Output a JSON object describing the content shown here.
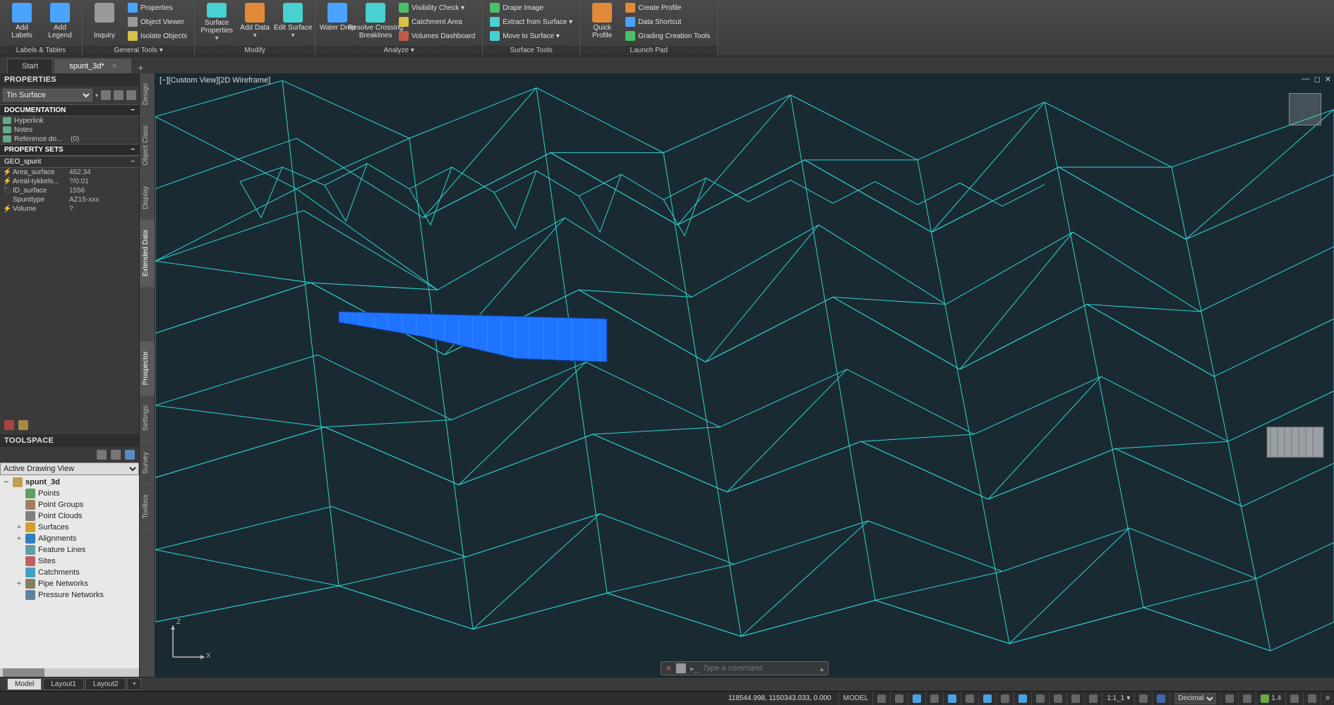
{
  "ribbon": {
    "groups": [
      {
        "label": "Labels & Tables",
        "big": [
          {
            "name": "add-labels",
            "label": "Add\nLabels",
            "ic": "blue"
          },
          {
            "name": "add-legend",
            "label": "Add\nLegend",
            "ic": "blue"
          }
        ]
      },
      {
        "label": "General Tools ▾",
        "big": [
          {
            "name": "inquiry",
            "label": "\nInquiry",
            "ic": "grey"
          }
        ],
        "stack": [
          {
            "name": "properties",
            "label": "Properties",
            "ic": "blue"
          },
          {
            "name": "object-viewer",
            "label": "Object Viewer",
            "ic": "grey"
          },
          {
            "name": "isolate-objects",
            "label": "Isolate Objects",
            "ic": "yellow"
          }
        ]
      },
      {
        "label": "Modify",
        "big": [
          {
            "name": "surface-properties",
            "label": "Surface\nProperties",
            "ic": "cyan",
            "dd": true
          },
          {
            "name": "add-data",
            "label": "Add Data\n",
            "ic": "orange",
            "dd": true
          },
          {
            "name": "edit-surface",
            "label": "Edit Surface\n",
            "ic": "cyan",
            "dd": true
          }
        ]
      },
      {
        "label": "Analyze ▾",
        "big": [
          {
            "name": "water-drop",
            "label": "Water Drop\n",
            "ic": "blue"
          },
          {
            "name": "resolve-crossing",
            "label": "Resolve Crossing\nBreaklines",
            "ic": "cyan"
          }
        ],
        "stack": [
          {
            "name": "visibility-check",
            "label": "Visibility Check ▾",
            "ic": "green"
          },
          {
            "name": "catchment-area",
            "label": "Catchment Area",
            "ic": "yellow"
          },
          {
            "name": "volumes-dashboard",
            "label": "Volumes Dashboard",
            "ic": "red"
          }
        ]
      },
      {
        "label": "Surface Tools",
        "stack": [
          {
            "name": "drape-image",
            "label": "Drape Image",
            "ic": "green"
          },
          {
            "name": "extract-surface",
            "label": "Extract from Surface ▾",
            "ic": "cyan"
          },
          {
            "name": "move-surface",
            "label": "Move to Surface ▾",
            "ic": "cyan"
          }
        ]
      },
      {
        "label": "Launch Pad",
        "big": [
          {
            "name": "quick-profile",
            "label": "Quick\nProfile",
            "ic": "orange"
          }
        ],
        "stack": [
          {
            "name": "create-profile",
            "label": "Create Profile",
            "ic": "orange"
          },
          {
            "name": "data-shortcut",
            "label": "Data Shortcut",
            "ic": "blue"
          },
          {
            "name": "grading-tools",
            "label": "Grading Creation Tools",
            "ic": "green"
          }
        ]
      }
    ]
  },
  "doctabs": {
    "tabs": [
      {
        "label": "Start",
        "active": false
      },
      {
        "label": "spunt_3d*",
        "active": true
      }
    ]
  },
  "properties": {
    "title": "PROPERTIES",
    "selector": "Tin Surface",
    "sections": [
      {
        "label": "DOCUMENTATION",
        "rows": [
          {
            "k": "Hyperlink",
            "v": "",
            "link": true
          },
          {
            "k": "Notes",
            "v": "",
            "link": true
          },
          {
            "k": "Reference do...",
            "v": "(0)",
            "link": true
          }
        ]
      },
      {
        "label": "PROPERTY SETS",
        "sub": "GEO_spunt",
        "rows": [
          {
            "k": "Area_surface",
            "v": "462.34",
            "fx": true
          },
          {
            "k": "Areal-tykkels...",
            "v": "?/0.01",
            "fx": true
          },
          {
            "k": "ID_surface",
            "v": "1556",
            "id": true
          },
          {
            "k": "Spunttype",
            "v": "AZ15-xxx"
          },
          {
            "k": "Volume",
            "v": "?",
            "fx": true
          }
        ]
      }
    ]
  },
  "toolspace": {
    "title": "TOOLSPACE",
    "view": "Active Drawing View",
    "vtabs": [
      "Prospector",
      "Settings",
      "Survey",
      "Toolbox"
    ],
    "tree": [
      {
        "label": "spunt_3d",
        "bold": true,
        "tw": "−",
        "ic": "#c0a050"
      },
      {
        "label": "Points",
        "indent": 1,
        "ic": "#60a060"
      },
      {
        "label": "Point Groups",
        "indent": 1,
        "ic": "#a08060"
      },
      {
        "label": "Point Clouds",
        "indent": 1,
        "ic": "#808080"
      },
      {
        "label": "Surfaces",
        "indent": 1,
        "tw": "+",
        "ic": "#d0a030"
      },
      {
        "label": "Alignments",
        "indent": 1,
        "tw": "+",
        "ic": "#3080c0"
      },
      {
        "label": "Feature Lines",
        "indent": 1,
        "ic": "#60a0a0"
      },
      {
        "label": "Sites",
        "indent": 1,
        "ic": "#c06060"
      },
      {
        "label": "Catchments",
        "indent": 1,
        "ic": "#40a0c0"
      },
      {
        "label": "Pipe Networks",
        "indent": 1,
        "tw": "+",
        "ic": "#808060"
      },
      {
        "label": "Pressure Networks",
        "indent": 1,
        "ic": "#6080a0"
      }
    ]
  },
  "viewport": {
    "label": "[−][Custom View][2D Wireframe]",
    "vtabs_left": [
      "Design",
      "Object Class",
      "Display",
      "Extended Data"
    ],
    "axis": {
      "up": "Z",
      "right": "X"
    }
  },
  "layout_tabs": [
    "Model",
    "Layout1",
    "Layout2"
  ],
  "command": {
    "placeholder": "Type a command"
  },
  "status": {
    "coords": "118544.998, 1150343.033, 0.000",
    "model": "MODEL",
    "scale": "1:1_1",
    "units": "Decimal",
    "v": "1.4"
  }
}
